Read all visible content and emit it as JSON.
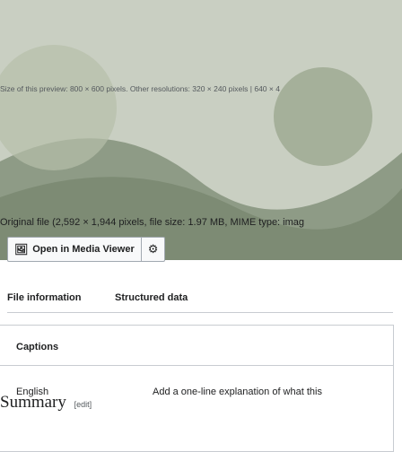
{
  "preview": {
    "size_text": "Size of this preview: 800 × 600 pixels. Other resolutions: 320 × 240 pixels | 640 × 4"
  },
  "file": {
    "original_text": "Original file (2,592 × 1,944 pixels, file size: 1.97 MB, MIME type: imag"
  },
  "buttons": {
    "open_media_viewer": "Open in Media Viewer",
    "settings_icon": "gear-icon",
    "media_icon": "image-icon"
  },
  "tabs": [
    {
      "label": "File information",
      "active": true
    },
    {
      "label": "Structured data",
      "active": false
    }
  ],
  "captions": {
    "title": "Captions",
    "language": "English",
    "add_text": "Add a one-line explanation of what this"
  },
  "summary": {
    "title": "Summary",
    "edit": "[edit]"
  },
  "colors": {
    "link_blue": "#3366cc",
    "border": "#a2a9b1"
  }
}
